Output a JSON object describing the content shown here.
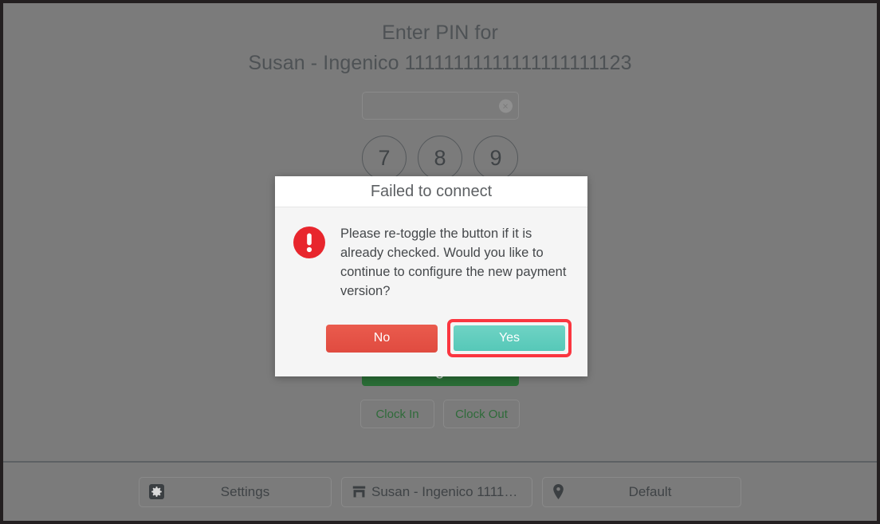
{
  "screen": {
    "background_color": "#7b7b7b",
    "border_color": "#231f20"
  },
  "login": {
    "title_line1": "Enter PIN for",
    "title_line2": "Susan - Ingenico 11111111111111111111123",
    "pin_input": {
      "value": "",
      "placeholder": "",
      "clear_icon": "clear-circle-icon",
      "clear_glyph": "×"
    },
    "keypad": [
      {
        "label": "7"
      },
      {
        "label": "8"
      },
      {
        "label": "9"
      }
    ],
    "login_button": "Log In",
    "clock_in_button": "Clock In",
    "clock_out_button": "Clock Out",
    "login_button_color": "#2a6d36",
    "clock_text_color": "#2f6b3a"
  },
  "bottom_bar": {
    "settings": {
      "icon": "gear-icon",
      "label": "Settings"
    },
    "terminal": {
      "icon": "store-icon",
      "label": "Susan - Ingenico 1111…"
    },
    "location": {
      "icon": "location-pin-icon",
      "label": "Default"
    }
  },
  "dialog": {
    "title": "Failed to connect",
    "icon": "error-exclamation-icon",
    "icon_color": "#e8262d",
    "message": "Please re-toggle the button if it is already checked. Would you like to continue to configure the new payment version?",
    "buttons": {
      "no": {
        "label": "No",
        "color": "#e04b40",
        "highlighted": "false"
      },
      "yes": {
        "label": "Yes",
        "color": "#56c8b8",
        "highlight_ring_color": "#fb3640",
        "highlighted": "true"
      }
    }
  }
}
